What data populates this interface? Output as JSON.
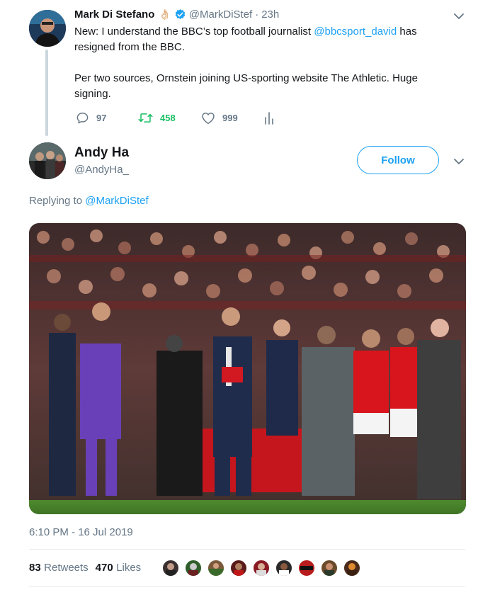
{
  "parent_tweet": {
    "author_name": "Mark Di Stefano",
    "emoji": "👌🏻",
    "handle": "@MarkDiStef",
    "separator": "·",
    "time_ago": "23h",
    "text_line1_a": "New: I understand the BBC’s top football journalist ",
    "mention": "@bbcsport_david",
    "text_line1_b": " has",
    "text_line2": "resigned from the BBC.",
    "text_line3": "Per two sources, Ornstein joining US-sporting website The Athletic. Huge",
    "text_line4": "signing.",
    "replies": "97",
    "retweets": "458",
    "likes": "999"
  },
  "reply_tweet": {
    "author_name": "Andy Ha",
    "handle": "@AndyHa_",
    "follow_label": "Follow",
    "replying_prefix": "Replying to ",
    "replying_to": "@MarkDiStef",
    "timestamp": "6:10 PM - 16 Jul 2019",
    "retweet_count": "83",
    "retweet_label": "Retweets",
    "like_count": "470",
    "like_label": "Likes"
  },
  "colors": {
    "accent": "#1da1f2",
    "retweet_green": "#17bf63",
    "muted": "#657786",
    "text": "#14171a",
    "divider": "#e6ecf0"
  },
  "icons": [
    "verified-badge-icon",
    "reply-icon",
    "retweet-icon",
    "like-icon",
    "analytics-icon",
    "chevron-down-icon"
  ]
}
